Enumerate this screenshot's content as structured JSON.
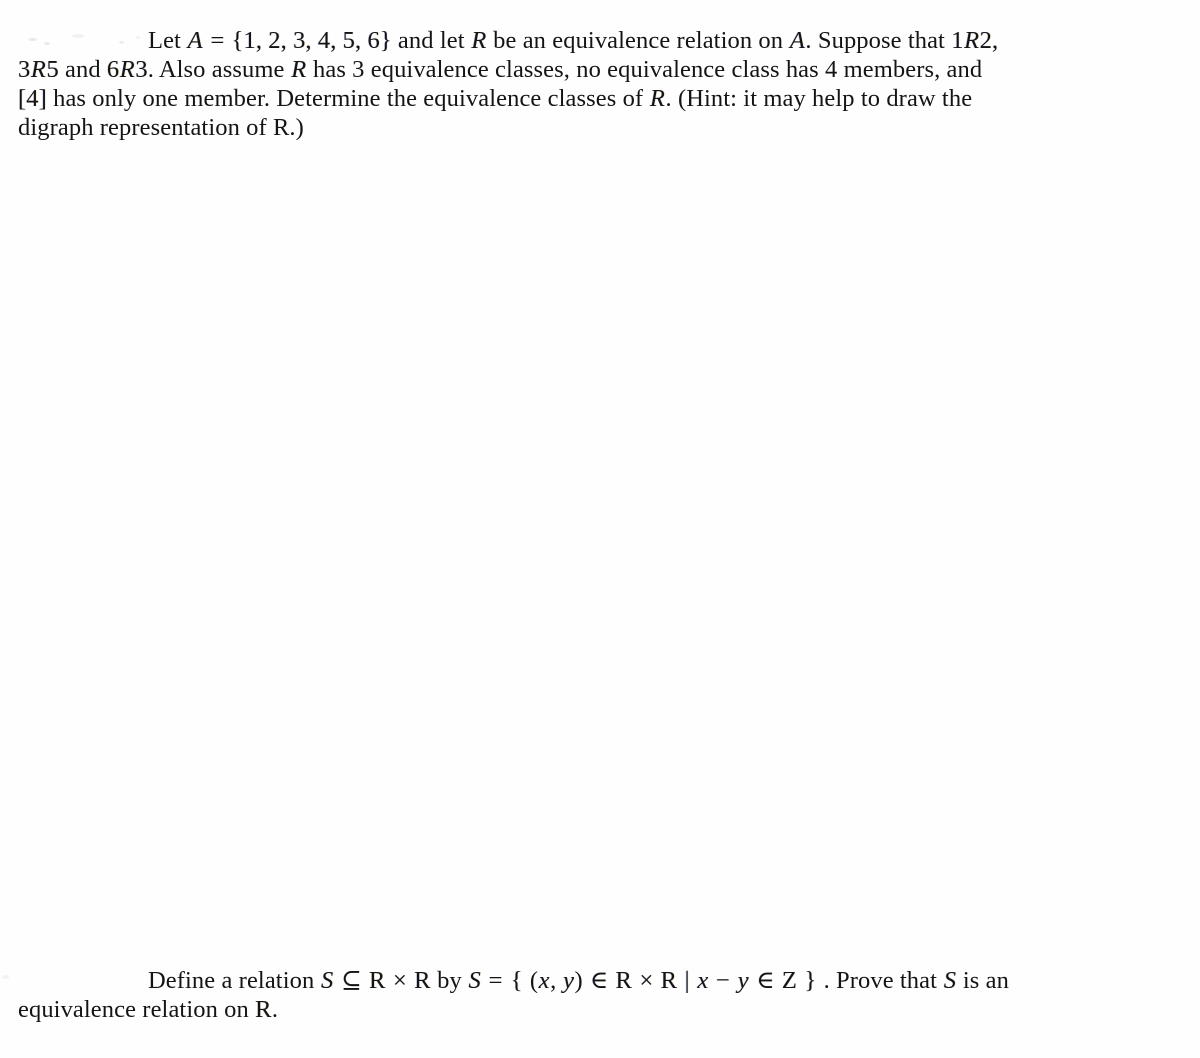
{
  "document": {
    "kind": "scanned-math-exercise-page",
    "background_color": "#fefefe",
    "text_color": "#141414",
    "problems": [
      {
        "id": "problem-equivalence-classes",
        "indent": true,
        "plain_text": "Let A = {1, 2, 3, 4, 5, 6} and let R be an equivalence relation on A. Suppose that 1R2, 3R5 and 6R3. Also assume R has 3 equivalence classes, no equivalence class has 4 members, and [4] has only one member. Determine the equivalence classes of R. (Hint: it may help to draw the digraph representation of R.)",
        "lines": [
          [
            {
              "t": "indent",
              "v": ""
            },
            {
              "t": "text",
              "v": "Let "
            },
            {
              "t": "mi",
              "v": "A"
            },
            {
              "t": "mo",
              "v": "="
            },
            {
              "t": "mn",
              "v": "{1, 2, 3, 4, 5, 6}"
            },
            {
              "t": "text",
              "v": " and let "
            },
            {
              "t": "mi",
              "v": "R"
            },
            {
              "t": "text",
              "v": " be an equivalence relation on "
            },
            {
              "t": "mi",
              "v": "A"
            },
            {
              "t": "text",
              "v": ".  Suppose that "
            },
            {
              "t": "mn",
              "v": "1"
            },
            {
              "t": "mi",
              "v": "R"
            },
            {
              "t": "mn",
              "v": "2,"
            }
          ],
          [
            {
              "t": "mn",
              "v": "3"
            },
            {
              "t": "mi",
              "v": "R"
            },
            {
              "t": "mn",
              "v": "5"
            },
            {
              "t": "text",
              "v": " and "
            },
            {
              "t": "mn",
              "v": "6"
            },
            {
              "t": "mi",
              "v": "R"
            },
            {
              "t": "mn",
              "v": "3"
            },
            {
              "t": "text",
              "v": ".  Also assume "
            },
            {
              "t": "mi",
              "v": "R"
            },
            {
              "t": "text",
              "v": " has 3 equivalence classes, no equivalence class has 4 members, and"
            }
          ],
          [
            {
              "t": "mn",
              "v": "[4]"
            },
            {
              "t": "text",
              "v": " has only one member.  Determine the equivalence classes of "
            },
            {
              "t": "mi",
              "v": "R"
            },
            {
              "t": "text",
              "v": ".  (Hint: it may help to draw the"
            }
          ],
          [
            {
              "t": "text",
              "v": "digraph representation of R.)"
            }
          ]
        ]
      },
      {
        "id": "problem-relation-on-reals",
        "indent": true,
        "plain_text": "Define a relation S ⊆ ℝ × ℝ by S = { (x, y) ∈ ℝ × ℝ | x − y ∈ ℤ }. Prove that S is an equivalence relation on ℝ.",
        "lines": [
          [
            {
              "t": "indent",
              "v": ""
            },
            {
              "t": "text",
              "v": "Define a relation "
            },
            {
              "t": "mi",
              "v": "S"
            },
            {
              "t": "mo",
              "v": "⊆"
            },
            {
              "t": "bb",
              "v": "R"
            },
            {
              "t": "mo",
              "v": "×"
            },
            {
              "t": "bb",
              "v": "R"
            },
            {
              "t": "text",
              "v": " by "
            },
            {
              "t": "mi",
              "v": "S"
            },
            {
              "t": "mo",
              "v": "="
            },
            {
              "t": "mo",
              "v": "{"
            },
            {
              "t": "text",
              "v": " ("
            },
            {
              "t": "mi",
              "v": "x"
            },
            {
              "t": "text",
              "v": ", "
            },
            {
              "t": "mi",
              "v": "y"
            },
            {
              "t": "text",
              "v": ") "
            },
            {
              "t": "mo",
              "v": "∈"
            },
            {
              "t": "bb",
              "v": "R"
            },
            {
              "t": "mo",
              "v": "×"
            },
            {
              "t": "bb",
              "v": "R"
            },
            {
              "t": "mo",
              "v": "|"
            },
            {
              "t": "mi",
              "v": "x"
            },
            {
              "t": "mo",
              "v": "−"
            },
            {
              "t": "mi",
              "v": "y"
            },
            {
              "t": "mo",
              "v": "∈"
            },
            {
              "t": "bb",
              "v": "Z"
            },
            {
              "t": "mo",
              "v": "}"
            },
            {
              "t": "text",
              "v": ".  Prove that "
            },
            {
              "t": "mi",
              "v": "S"
            },
            {
              "t": "text",
              "v": " is an"
            }
          ],
          [
            {
              "t": "text",
              "v": "equivalence relation on "
            },
            {
              "t": "bb",
              "v": "R"
            },
            {
              "t": "text",
              "v": "."
            }
          ]
        ]
      }
    ]
  }
}
